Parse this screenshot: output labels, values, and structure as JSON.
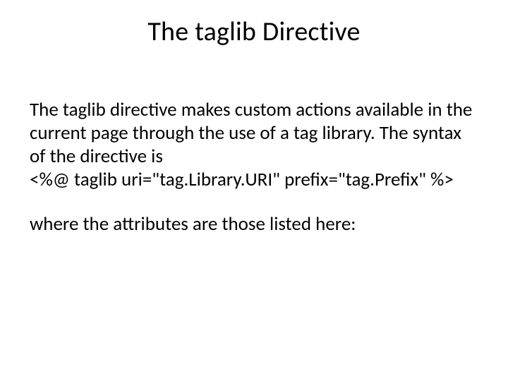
{
  "title": "The taglib Directive",
  "paragraph1": "The taglib directive makes custom actions available in the current page through the use of a tag library. The syntax of the directive is",
  "codeLine": "<%@ taglib uri=\"tag.Library.URI\" prefix=\"tag.Prefix\" %>",
  "paragraph2": "where the attributes are those listed here:"
}
